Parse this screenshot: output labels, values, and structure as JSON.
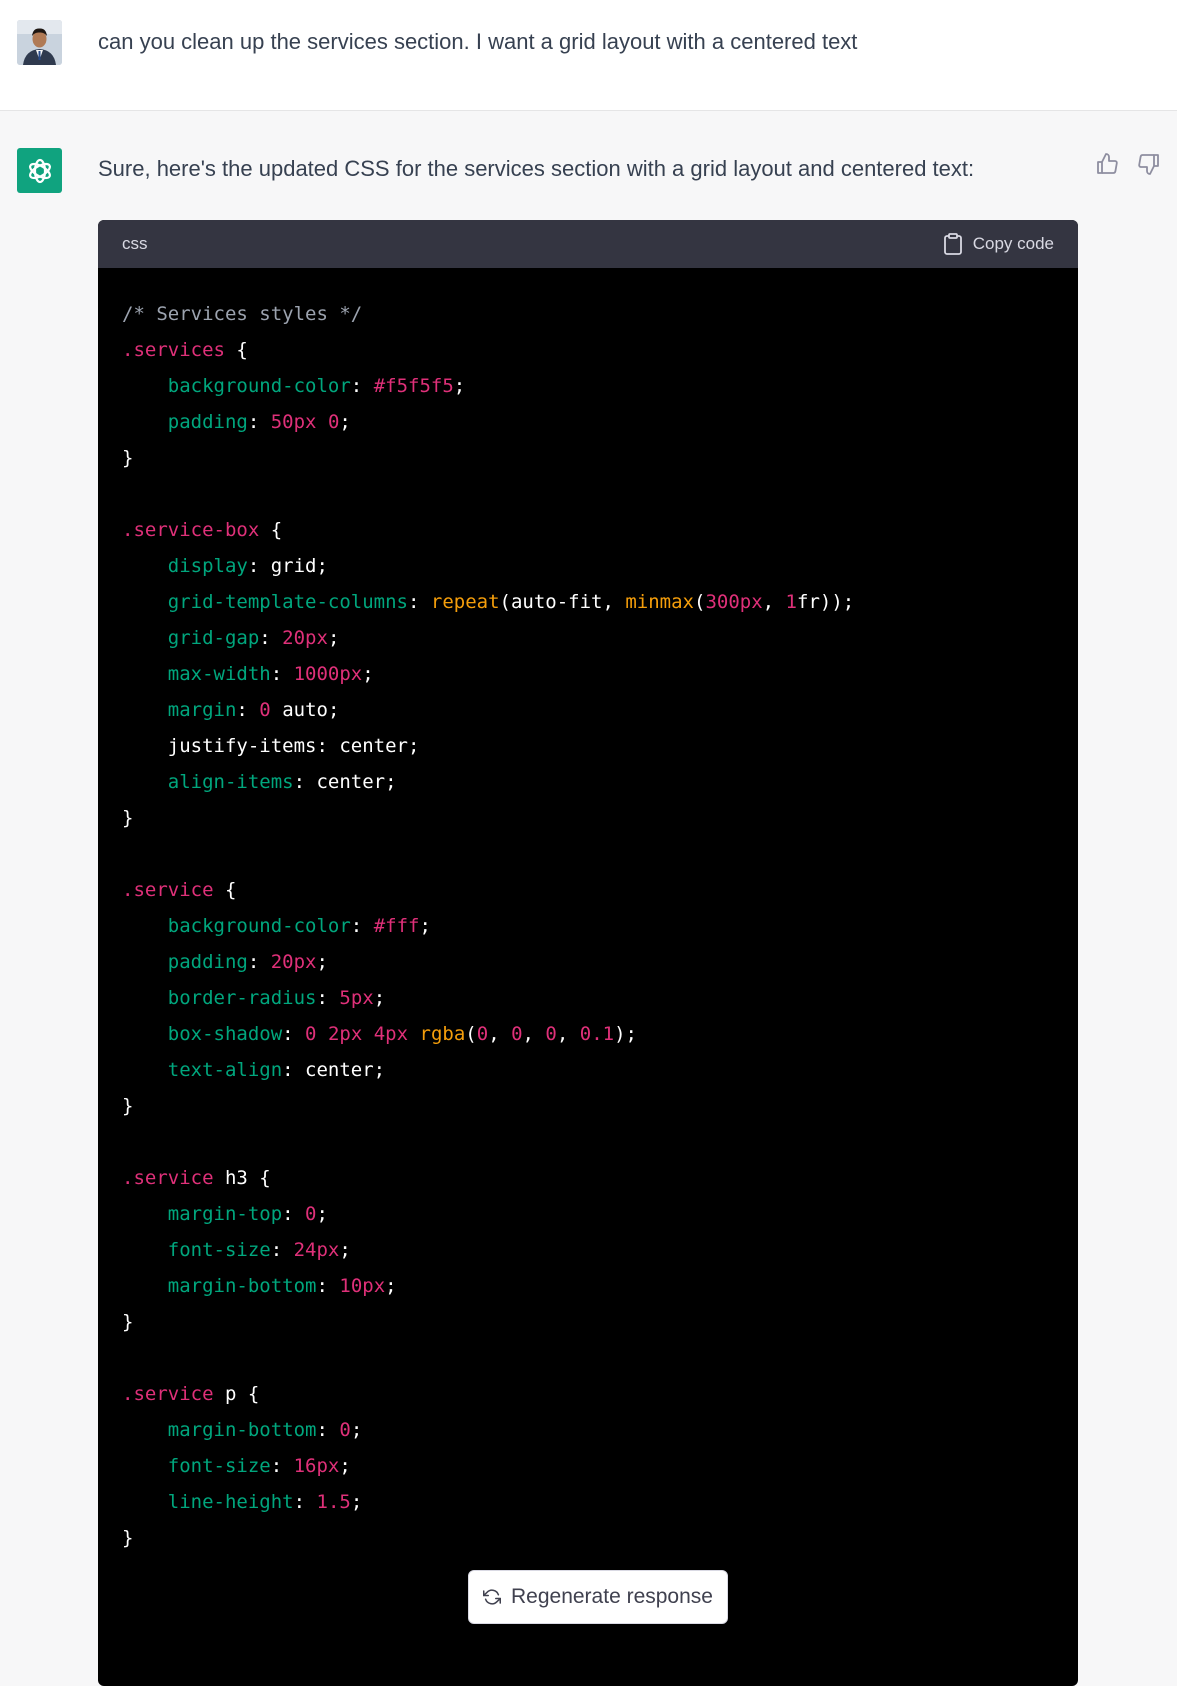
{
  "user": {
    "message": "can you clean up the services section. I want a grid layout with a centered text"
  },
  "assistant": {
    "message": "Sure, here's the updated CSS for the services section with a grid layout and centered text:"
  },
  "code_block": {
    "language": "css",
    "copy_label": "Copy code",
    "lines": [
      [
        [
          "com",
          "/* Services styles */"
        ]
      ],
      [
        [
          "sel",
          ".services"
        ],
        [
          "txt",
          " {"
        ]
      ],
      [
        [
          "txt",
          "    "
        ],
        [
          "prop",
          "background-color"
        ],
        [
          "txt",
          ": "
        ],
        [
          "num",
          "#f5f5f5"
        ],
        [
          "txt",
          ";"
        ]
      ],
      [
        [
          "txt",
          "    "
        ],
        [
          "prop",
          "padding"
        ],
        [
          "txt",
          ": "
        ],
        [
          "num",
          "50px"
        ],
        [
          "txt",
          " "
        ],
        [
          "num",
          "0"
        ],
        [
          "txt",
          ";"
        ]
      ],
      [
        [
          "txt",
          "}"
        ]
      ],
      [],
      [
        [
          "sel",
          ".service-box"
        ],
        [
          "txt",
          " {"
        ]
      ],
      [
        [
          "txt",
          "    "
        ],
        [
          "prop",
          "display"
        ],
        [
          "txt",
          ": grid;"
        ]
      ],
      [
        [
          "txt",
          "    "
        ],
        [
          "prop",
          "grid-template-columns"
        ],
        [
          "txt",
          ": "
        ],
        [
          "fn",
          "repeat"
        ],
        [
          "txt",
          "(auto-fit, "
        ],
        [
          "fn",
          "minmax"
        ],
        [
          "txt",
          "("
        ],
        [
          "num",
          "300px"
        ],
        [
          "txt",
          ", "
        ],
        [
          "num",
          "1"
        ],
        [
          "txt",
          "fr));"
        ]
      ],
      [
        [
          "txt",
          "    "
        ],
        [
          "prop",
          "grid-gap"
        ],
        [
          "txt",
          ": "
        ],
        [
          "num",
          "20px"
        ],
        [
          "txt",
          ";"
        ]
      ],
      [
        [
          "txt",
          "    "
        ],
        [
          "prop",
          "max-width"
        ],
        [
          "txt",
          ": "
        ],
        [
          "num",
          "1000px"
        ],
        [
          "txt",
          ";"
        ]
      ],
      [
        [
          "txt",
          "    "
        ],
        [
          "prop",
          "margin"
        ],
        [
          "txt",
          ": "
        ],
        [
          "num",
          "0"
        ],
        [
          "txt",
          " auto;"
        ]
      ],
      [
        [
          "txt",
          "    justify-items: center;"
        ]
      ],
      [
        [
          "txt",
          "    "
        ],
        [
          "prop",
          "align-items"
        ],
        [
          "txt",
          ": center;"
        ]
      ],
      [
        [
          "txt",
          "}"
        ]
      ],
      [],
      [
        [
          "sel",
          ".service"
        ],
        [
          "txt",
          " {"
        ]
      ],
      [
        [
          "txt",
          "    "
        ],
        [
          "prop",
          "background-color"
        ],
        [
          "txt",
          ": "
        ],
        [
          "num",
          "#fff"
        ],
        [
          "txt",
          ";"
        ]
      ],
      [
        [
          "txt",
          "    "
        ],
        [
          "prop",
          "padding"
        ],
        [
          "txt",
          ": "
        ],
        [
          "num",
          "20px"
        ],
        [
          "txt",
          ";"
        ]
      ],
      [
        [
          "txt",
          "    "
        ],
        [
          "prop",
          "border-radius"
        ],
        [
          "txt",
          ": "
        ],
        [
          "num",
          "5px"
        ],
        [
          "txt",
          ";"
        ]
      ],
      [
        [
          "txt",
          "    "
        ],
        [
          "prop",
          "box-shadow"
        ],
        [
          "txt",
          ": "
        ],
        [
          "num",
          "0"
        ],
        [
          "txt",
          " "
        ],
        [
          "num",
          "2px"
        ],
        [
          "txt",
          " "
        ],
        [
          "num",
          "4px"
        ],
        [
          "txt",
          " "
        ],
        [
          "fn",
          "rgba"
        ],
        [
          "txt",
          "("
        ],
        [
          "num",
          "0"
        ],
        [
          "txt",
          ", "
        ],
        [
          "num",
          "0"
        ],
        [
          "txt",
          ", "
        ],
        [
          "num",
          "0"
        ],
        [
          "txt",
          ", "
        ],
        [
          "num",
          "0.1"
        ],
        [
          "txt",
          ");"
        ]
      ],
      [
        [
          "txt",
          "    "
        ],
        [
          "prop",
          "text-align"
        ],
        [
          "txt",
          ": center;"
        ]
      ],
      [
        [
          "txt",
          "}"
        ]
      ],
      [],
      [
        [
          "sel",
          ".service"
        ],
        [
          "txt",
          " h3 {"
        ]
      ],
      [
        [
          "txt",
          "    "
        ],
        [
          "prop",
          "margin-top"
        ],
        [
          "txt",
          ": "
        ],
        [
          "num",
          "0"
        ],
        [
          "txt",
          ";"
        ]
      ],
      [
        [
          "txt",
          "    "
        ],
        [
          "prop",
          "font-size"
        ],
        [
          "txt",
          ": "
        ],
        [
          "num",
          "24px"
        ],
        [
          "txt",
          ";"
        ]
      ],
      [
        [
          "txt",
          "    "
        ],
        [
          "prop",
          "margin-bottom"
        ],
        [
          "txt",
          ": "
        ],
        [
          "num",
          "10px"
        ],
        [
          "txt",
          ";"
        ]
      ],
      [
        [
          "txt",
          "}"
        ]
      ],
      [],
      [
        [
          "sel",
          ".service"
        ],
        [
          "txt",
          " p {"
        ]
      ],
      [
        [
          "txt",
          "    "
        ],
        [
          "prop",
          "margin-bottom"
        ],
        [
          "txt",
          ": "
        ],
        [
          "num",
          "0"
        ],
        [
          "txt",
          ";"
        ]
      ],
      [
        [
          "txt",
          "    "
        ],
        [
          "prop",
          "font-size"
        ],
        [
          "txt",
          ": "
        ],
        [
          "num",
          "16px"
        ],
        [
          "txt",
          ";"
        ]
      ],
      [
        [
          "txt",
          "    "
        ],
        [
          "prop",
          "line-height"
        ],
        [
          "txt",
          ": "
        ],
        [
          "num",
          "1.5"
        ],
        [
          "txt",
          ";"
        ]
      ],
      [
        [
          "txt",
          "}"
        ]
      ]
    ]
  },
  "regenerate_label": "Regenerate response",
  "colors": {
    "gpt_brand": "#10a37f",
    "code_selector": "#df3079",
    "code_property": "#00a67d",
    "code_function": "#f59e0b",
    "code_comment": "#9ca3af"
  },
  "icons": {
    "user_avatar": "user-avatar",
    "assistant_avatar": "openai-logo-icon",
    "thumbs_up": "thumbs-up-icon",
    "thumbs_down": "thumbs-down-icon",
    "copy": "clipboard-icon",
    "regenerate": "refresh-icon"
  }
}
